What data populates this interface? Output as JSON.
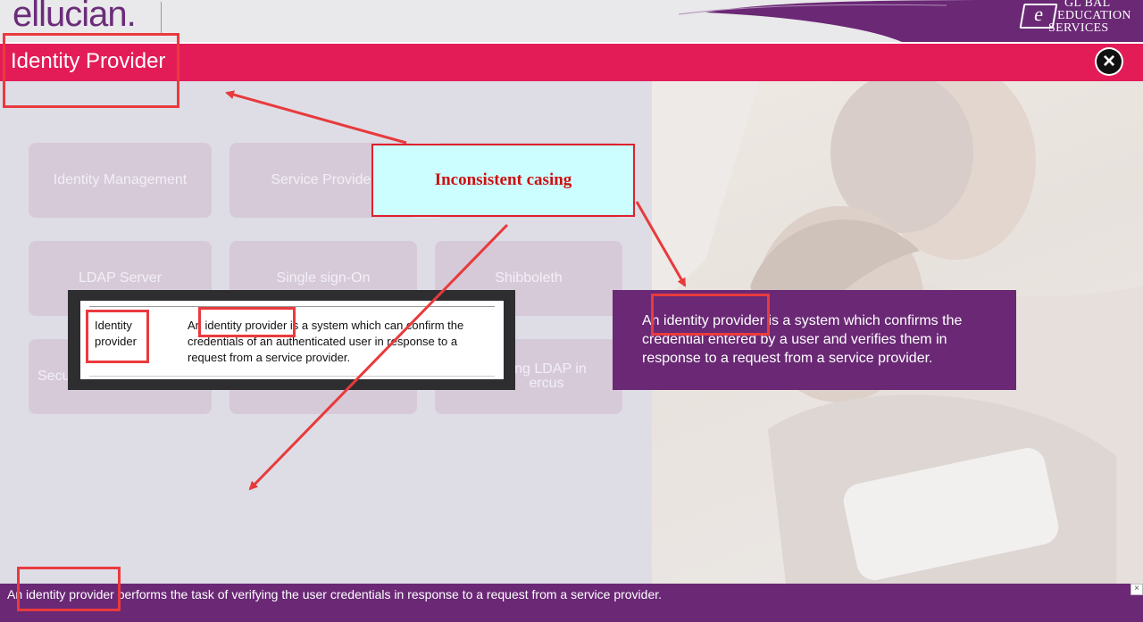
{
  "header": {
    "logo": "ellucian.",
    "brand_icon": "e",
    "brand_lines": [
      "GL   BAL",
      "EDUCATION",
      "SERVICES"
    ],
    "title": "Identity Provider",
    "close_icon": "close-icon"
  },
  "tiles": [
    {
      "label": "Identity Management"
    },
    {
      "label": "Service Provider"
    },
    {
      "label": ""
    },
    {
      "label": "LDAP Server"
    },
    {
      "label": "Single sign-On"
    },
    {
      "label": "Shibboleth"
    },
    {
      "label": "Secu                   l"
    },
    {
      "label": ""
    },
    {
      "label": "ring LDAP in ercus"
    }
  ],
  "glossary": {
    "term": "Identity provider",
    "definition": "An identity provider is a system which can confirm the credentials of an authenticated user in response to a request from a service provider."
  },
  "info_panel": {
    "text": "An identity provider is a system which confirms the credential entered by a user and verifies them in response to a request from a service provider."
  },
  "footer": {
    "text": "An identity provider performs the task of verifying the user credentials in response to a request from a service provider.",
    "close_label": "×"
  },
  "annotation": {
    "callout": "Inconsistent casing"
  },
  "colors": {
    "title_bar": "#e31c58",
    "brand_purple": "#6a2875",
    "annotation_red": "#e0202c",
    "callout_bg": "#ccfdff"
  }
}
